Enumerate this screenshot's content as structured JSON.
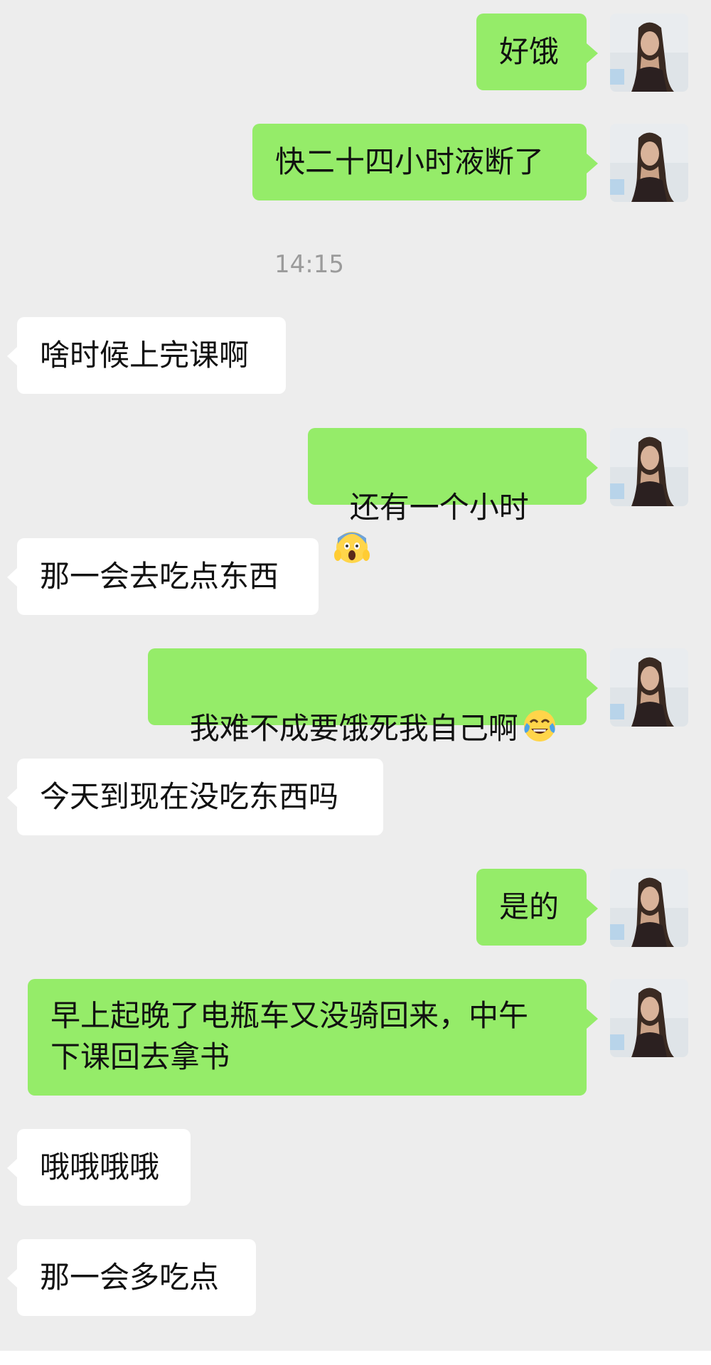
{
  "chat": {
    "timestamp": "14:15",
    "messages": [
      {
        "side": "sent",
        "text": "好饿"
      },
      {
        "side": "sent",
        "text": "快二十四小时液断了"
      },
      {
        "side": "recv",
        "text": "啥时候上完课啊"
      },
      {
        "side": "sent",
        "text": "还有一个小时",
        "emoji": "scream-emoji"
      },
      {
        "side": "recv",
        "text": "那一会去吃点东西"
      },
      {
        "side": "sent",
        "text": "我难不成要饿死我自己啊",
        "emoji": "tears-of-joy-emoji"
      },
      {
        "side": "recv",
        "text": "今天到现在没吃东西吗"
      },
      {
        "side": "sent",
        "text": "是的"
      },
      {
        "side": "sent",
        "text": "早上起晚了电瓶车又没骑回来，中午\n下课回去拿书"
      },
      {
        "side": "recv",
        "text": "哦哦哦哦"
      },
      {
        "side": "recv",
        "text": "那一会多吃点"
      }
    ]
  },
  "colors": {
    "background": "#ededed",
    "sent_bubble": "#95ec69",
    "recv_bubble": "#ffffff"
  }
}
